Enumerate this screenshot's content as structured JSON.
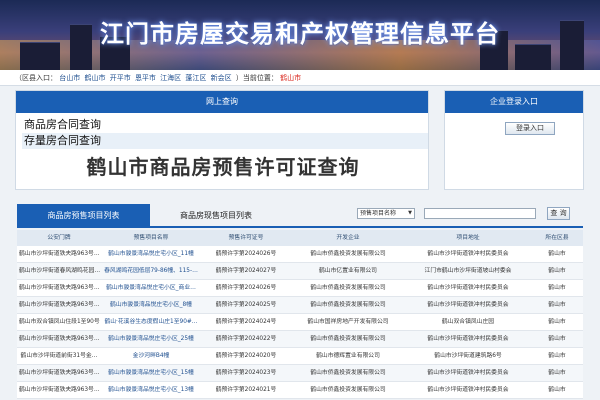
{
  "banner": {
    "title": "江门市房屋交易和产权管理信息平台"
  },
  "region_bar": {
    "prefix": "（区县入口：",
    "links": [
      "台山市",
      "鹤山市",
      "开平市",
      "恩平市",
      "江海区",
      "蓬江区",
      "新会区"
    ],
    "suffix": "）当前位置：",
    "current": "鹤山市"
  },
  "online_query": {
    "heading": "网上查询",
    "items": [
      "商品房合同查询",
      "存量房合同查询"
    ],
    "big_title": "鹤山市商品房预售许可证查询"
  },
  "login": {
    "heading": "企业登录入口",
    "button": "登录入口"
  },
  "tabs": {
    "active": "商品房预售项目列表",
    "other": "商品房现售项目列表",
    "filter_selected": "预售项目名称",
    "search_button": "查 询"
  },
  "table": {
    "columns": [
      "公安门牌",
      "预售项目名称",
      "预售许可证号",
      "开发企业",
      "项目地址",
      "所在区县"
    ],
    "rows": [
      [
        "鹤山市沙坪街道铁夫路963号…",
        "鹤山市骏景湾品悦庄宅小区_11幢",
        "鹤预许字第2024026号",
        "鹤山市侨鑫投资发展有限公司",
        "鹤山市沙坪街道铁冲村民委员会",
        "鹤山市"
      ],
      [
        "鹤山市沙坪街道春风湖鸣花园…",
        "春风湖鸣花园低层79-86幢、115-…",
        "鹤预许字第2024027号",
        "鹤山市亿置业有限公司",
        "江门市鹤山市沙坪街道坡山村委会",
        "鹤山市"
      ],
      [
        "鹤山市沙坪街道铁夫路963号…",
        "鹤山市骏景湾品悦庄宅小区_商业…",
        "鹤预许字第2024026号",
        "鹤山市侨鑫投资发展有限公司",
        "鹤山市沙坪街道铁冲村民委员会",
        "鹤山市"
      ],
      [
        "鹤山市沙坪街道铁夫路963号…",
        "鹤山市骏景湾品悦庄宅小区_8幢",
        "鹤预许字第2024025号",
        "鹤山市侨鑫投资发展有限公司",
        "鹤山市沙坪街道铁冲村民委员会",
        "鹤山市"
      ],
      [
        "鹤山市双合镇凤山住段1至90号",
        "鹤山·花溪谷生态度假山庄1至90#…",
        "鹤预许字第2024024号",
        "鹤山市国祥房地产开发有限公司",
        "鹤山双合镇凤山庄园",
        "鹤山市"
      ],
      [
        "鹤山市沙坪街道铁夫路963号…",
        "鹤山市骏景湾品悦庄宅小区_25幢",
        "鹤预许字第2024022号",
        "鹤山市侨鑫投资发展有限公司",
        "鹤山市沙坪街道铁冲村民委员会",
        "鹤山市"
      ],
      [
        "鹤山市沙坪街道前街31号金…",
        "金沙河畔B4幢",
        "鹤预许字第2024020号",
        "鹤山市德辉置业有限公司",
        "鹤山市沙坪街道建筑路6号",
        "鹤山市"
      ],
      [
        "鹤山市沙坪街道铁夫路963号…",
        "鹤山市骏景湾品悦庄宅小区_15幢",
        "鹤预许字第2024023号",
        "鹤山市侨鑫投资发展有限公司",
        "鹤山市沙坪街道铁冲村民委员会",
        "鹤山市"
      ],
      [
        "鹤山市沙坪街道铁夫路963号…",
        "鹤山市骏景湾品悦庄宅小区_13幢",
        "鹤预许字第2024021号",
        "鹤山市侨鑫投资发展有限公司",
        "鹤山市沙坪街道铁冲村民委员会",
        "鹤山市"
      ]
    ]
  }
}
